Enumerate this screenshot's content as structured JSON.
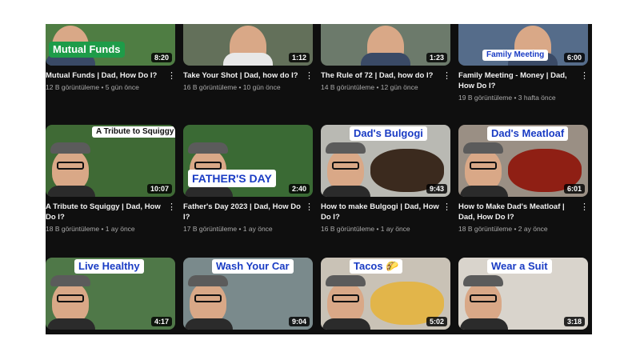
{
  "videos": [
    {
      "title": "Mutual Funds | Dad, How Do I?",
      "meta": "12 B görüntüleme • 5 gün önce",
      "duration": "8:20",
      "thumb_text": "Mutual Funds",
      "bg": "#4f7d43"
    },
    {
      "title": "Take Your Shot | Dad, how do I?",
      "meta": "16 B görüntüleme • 10 gün önce",
      "duration": "1:12",
      "thumb_text": "",
      "bg": "#63705a"
    },
    {
      "title": "The Rule of 72 | Dad, how do I?",
      "meta": "14 B görüntüleme • 12 gün önce",
      "duration": "1:23",
      "thumb_text": "",
      "bg": "#6c7a6b"
    },
    {
      "title": "Family Meeting - Money | Dad, How Do I?",
      "meta": "19 B görüntüleme • 3 hafta önce",
      "duration": "6:00",
      "thumb_text": "Family Meeting",
      "bg": "#556c8a"
    },
    {
      "title": "A Tribute to Squiggy | Dad, How Do I?",
      "meta": "18 B görüntüleme • 1 ay önce",
      "duration": "10:07",
      "thumb_text": "A Tribute to Squiggy",
      "bg": "#3f6a35"
    },
    {
      "title": "Father's Day 2023 | Dad, How Do I?",
      "meta": "17 B görüntüleme • 1 ay önce",
      "duration": "2:40",
      "thumb_text": "FATHER'S DAY",
      "bg": "#3a6a34"
    },
    {
      "title": "How to make Bulgogi | Dad, How Do I?",
      "meta": "16 B görüntüleme • 1 ay önce",
      "duration": "9:43",
      "thumb_text": "Dad's Bulgogi",
      "bg": "#b9b9b3"
    },
    {
      "title": "How to Make Dad's Meatloaf | Dad, How Do I?",
      "meta": "18 B görüntüleme • 2 ay önce",
      "duration": "6:01",
      "thumb_text": "Dad's Meatloaf",
      "bg": "#9a8f84"
    },
    {
      "title": "",
      "meta": "",
      "duration": "4:17",
      "thumb_text": "Live Healthy",
      "bg": "#4f7848"
    },
    {
      "title": "",
      "meta": "",
      "duration": "9:04",
      "thumb_text": "Wash Your Car",
      "bg": "#7a8a8c"
    },
    {
      "title": "",
      "meta": "",
      "duration": "5:02",
      "thumb_text": "Tacos 🌮",
      "bg": "#c9c2b6"
    },
    {
      "title": "",
      "meta": "",
      "duration": "3:18",
      "thumb_text": "Wear a Suit",
      "bg": "#d9d4cc"
    }
  ],
  "colors": {
    "page": "#0f0f0f",
    "title": "#f1f1f1",
    "meta": "#aaaaaa",
    "label_blue": "#1a3cc4",
    "label_green": "#1e9c49"
  },
  "icons": {
    "more": "more-vertical-icon"
  }
}
